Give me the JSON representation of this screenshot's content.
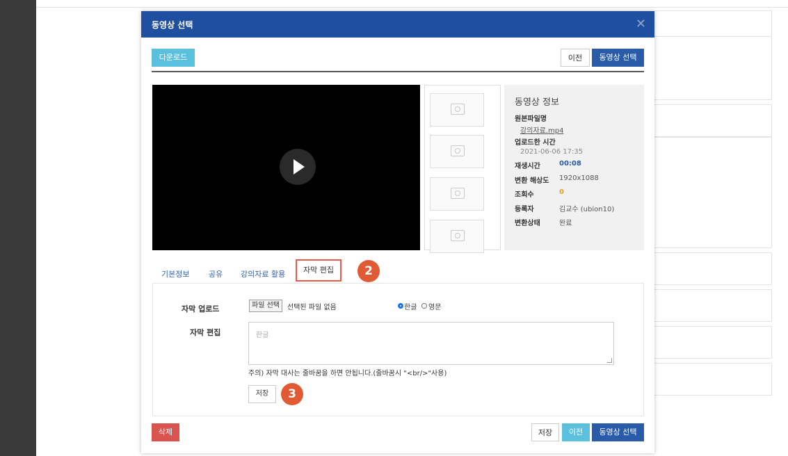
{
  "modal": {
    "title": "동영상 선택",
    "close_icon": "close-icon"
  },
  "toolbar_top": {
    "download_label": "다운로드",
    "prev_label": "이전",
    "select_label": "동영상 선택"
  },
  "video": {
    "play_icon": "play-icon"
  },
  "info": {
    "heading": "동영상 정보",
    "original_filename_label": "원본파일명",
    "original_filename": "강의자료.mp4",
    "uploaded_label": "업로드한 시간",
    "uploaded_value": "2021-06-06 17:35",
    "duration_label": "재생시간",
    "duration_value": "00:08",
    "resolution_label": "변환 해상도",
    "resolution_value": "1920x1088",
    "views_label": "조회수",
    "views_value": "0",
    "author_label": "등록자",
    "author_value": "김교수 (ubion10)",
    "status_label": "변환상태",
    "status_value": "완료"
  },
  "tabs": {
    "basic": "기본정보",
    "share": "공유",
    "material": "강의자료 활용",
    "subtitle": "자막 편집"
  },
  "badges": {
    "tab_step": "2",
    "save_step": "3"
  },
  "subtitle_form": {
    "upload_label": "자막 업로드",
    "file_button": "파일 선택",
    "no_file": "선택된 파일 없음",
    "radio_korean": "한글",
    "radio_english": "영문",
    "edit_label": "자막 편집",
    "textarea_placeholder": "한글",
    "notice": "주의) 자막 대사는 줄바꿈을 하면 안됩니다.(줄바꿈시 \"<br/>\"사용)",
    "save_label": "저장"
  },
  "footer": {
    "delete_label": "삭제",
    "save_label": "저장",
    "prev_label": "이전",
    "select_label": "동영상 선택"
  },
  "colors": {
    "header": "#1f4f9f",
    "accent_cyan": "#5bc0de",
    "primary_blue": "#2a5ba8",
    "danger_red": "#d9534f",
    "badge_orange": "#e05a35",
    "duration_blue": "#2a5ba8",
    "views_orange": "#e8a020"
  }
}
